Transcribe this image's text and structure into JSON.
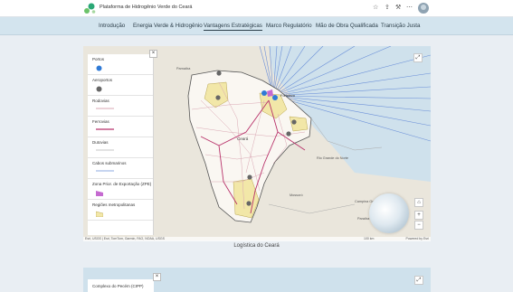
{
  "header": {
    "title": "Plataforma de Hidrogênio Verde do Ceará",
    "icons": [
      "star-icon",
      "share-icon",
      "tools-icon",
      "more-icon",
      "avatar"
    ]
  },
  "nav": {
    "tabs": [
      {
        "label": "Introdução"
      },
      {
        "label": "Energia Verde & Hidrogênio"
      },
      {
        "label": "Vantagens Estratégicas",
        "active": true
      },
      {
        "label": "Marco Regulatório"
      },
      {
        "label": "Mão de Obra Qualificada"
      },
      {
        "label": "Transição Justa"
      }
    ]
  },
  "map": {
    "caption": "Logística do Ceará",
    "legend": [
      {
        "label": "Portos",
        "symbol": "port-icon"
      },
      {
        "label": "Aeroportos",
        "symbol": "airport-icon"
      },
      {
        "label": "Rodovias",
        "symbol": "road-line"
      },
      {
        "label": "Ferrovias",
        "symbol": "railway-line"
      },
      {
        "label": "Dutovias",
        "symbol": "pipeline-line"
      },
      {
        "label": "Cabos submarinos",
        "symbol": "cable-line"
      },
      {
        "label": "Zona Prior. de Exportação (ZPE)",
        "symbol": "zpe-polygon"
      },
      {
        "label": "Regiões metropolitanas",
        "symbol": "metro-polygon"
      }
    ],
    "labels": {
      "ceara": "Ceará",
      "piaui": "Piauí",
      "rn": "Rio Grande do Norte",
      "paraiba": "Paraíba",
      "fortaleza": "Fortaleza",
      "parnaiba": "Parnaíba",
      "mossoro": "Mossoró",
      "campina": "Campina Grande",
      "teresina": "Teresina"
    },
    "attribution": "Esri, USGS | Esri, TomTom, Garmin, FAO, NOAA, USGS",
    "scale": "100 km",
    "powered_by": "Powered by Esri",
    "controls": {
      "close": "×",
      "expand": "⤢",
      "home": "⌂",
      "zoom_in": "+",
      "zoom_out": "−"
    }
  },
  "map2": {
    "legend_label": "Complexo do Pecém (CIPP)",
    "close": "×",
    "expand": "⤢"
  }
}
